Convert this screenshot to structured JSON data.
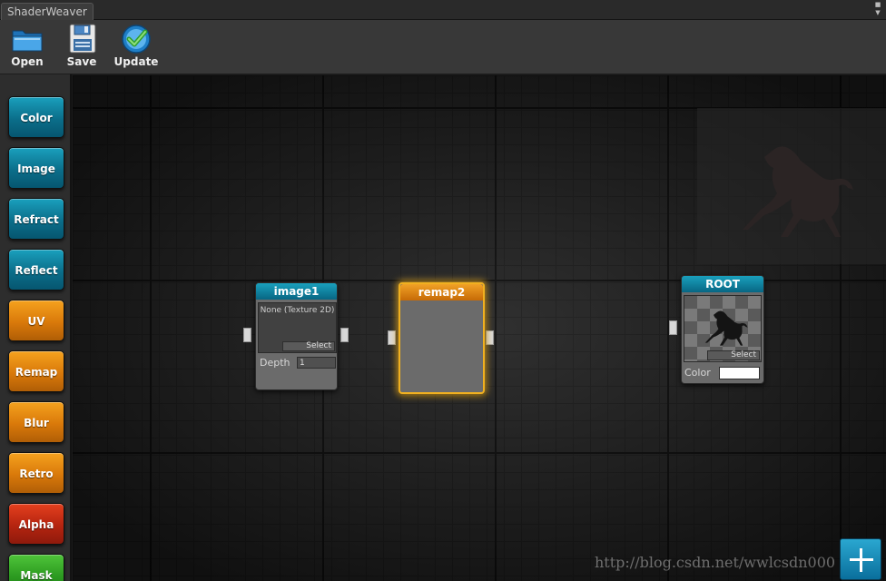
{
  "window": {
    "tab_title": "ShaderWeaver"
  },
  "toolbar": {
    "buttons": [
      {
        "label": "Open",
        "icon": "folder-icon"
      },
      {
        "label": "Save",
        "icon": "floppy-disk-icon"
      },
      {
        "label": "Update",
        "icon": "checkmark-icon"
      }
    ]
  },
  "sidebar": {
    "items": [
      {
        "label": "Color",
        "color": "#0b6e8a"
      },
      {
        "label": "Image",
        "color": "#0b6e8a"
      },
      {
        "label": "Refract",
        "color": "#0b6e8a"
      },
      {
        "label": "Reflect",
        "color": "#0b6e8a"
      },
      {
        "label": "UV",
        "color": "#d9790a"
      },
      {
        "label": "Remap",
        "color": "#d9790a"
      },
      {
        "label": "Blur",
        "color": "#d9790a"
      },
      {
        "label": "Retro",
        "color": "#d9790a"
      },
      {
        "label": "Alpha",
        "color": "#b52410"
      },
      {
        "label": "Mask",
        "color": "#2c9a20"
      }
    ]
  },
  "nodes": {
    "image1": {
      "title": "image1",
      "texture_text": "None (Texture 2D)",
      "select_label": "Select",
      "depth_label": "Depth",
      "depth_value": "1"
    },
    "remap2": {
      "title": "remap2",
      "highlight_color": "#f0b020"
    },
    "root": {
      "title": "ROOT",
      "select_label": "Select",
      "color_label": "Color",
      "color_value": "#ffffff"
    }
  },
  "canvas": {
    "watermark": "http://blog.csdn.net/wwlcsdn000"
  }
}
